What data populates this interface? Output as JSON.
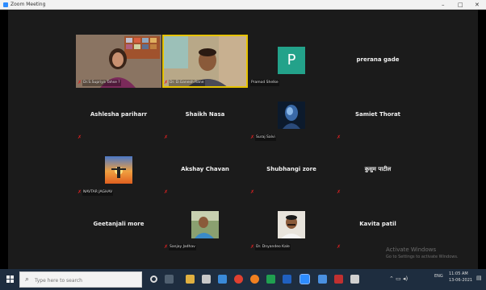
{
  "window": {
    "title": "Zoom Meeting",
    "buttons": [
      "–",
      "□",
      "✕"
    ]
  },
  "participants": [
    {
      "name": "Dr.S.Supriya Tahse ?",
      "muted": true,
      "kind": "video"
    },
    {
      "name": "Dr. D.Ganesh Rane",
      "muted": true,
      "kind": "video",
      "active": true
    },
    {
      "name": "Pramod Shelke",
      "muted": false,
      "kind": "avatar",
      "initial": "P"
    },
    {
      "name": "prerana gade",
      "muted": false,
      "kind": "name"
    },
    {
      "name": "Ashlesha pariharr",
      "muted": true,
      "kind": "name"
    },
    {
      "name": "Shaikh Nasa",
      "muted": true,
      "kind": "name"
    },
    {
      "name": "Suraj Salvi",
      "muted": true,
      "kind": "photo"
    },
    {
      "name": "Samiet Thorat",
      "muted": true,
      "kind": "name"
    },
    {
      "name": "NAVTAR JAGHAV",
      "muted": true,
      "kind": "photo"
    },
    {
      "name": "Akshay Chavan",
      "muted": true,
      "kind": "name"
    },
    {
      "name": "Shubhangi zore",
      "muted": true,
      "kind": "name"
    },
    {
      "name": "कुसुम पाटील",
      "muted": true,
      "kind": "name"
    },
    {
      "name": "Geetanjali more",
      "muted": false,
      "kind": "name"
    },
    {
      "name": "Sanjay Jadhav",
      "muted": true,
      "kind": "photo"
    },
    {
      "name": "Dr. Dnyandeo Kale",
      "muted": true,
      "kind": "photo"
    },
    {
      "name": "Kavita patil",
      "muted": true,
      "kind": "name"
    }
  ],
  "activation": {
    "line1": "Activate Windows",
    "line2": "Go to Settings to activate Windows."
  },
  "taskbar": {
    "search_placeholder": "Type here to search",
    "language": "ENG",
    "time": "11:05 AM",
    "date": "13-06-2021"
  },
  "colors": {
    "stage": "#1b1b1b",
    "active_speaker": "#e6c200",
    "muted_icon": "#e02020",
    "avatar_bg": "#23a28a",
    "taskbar": "#1e2d3f"
  }
}
